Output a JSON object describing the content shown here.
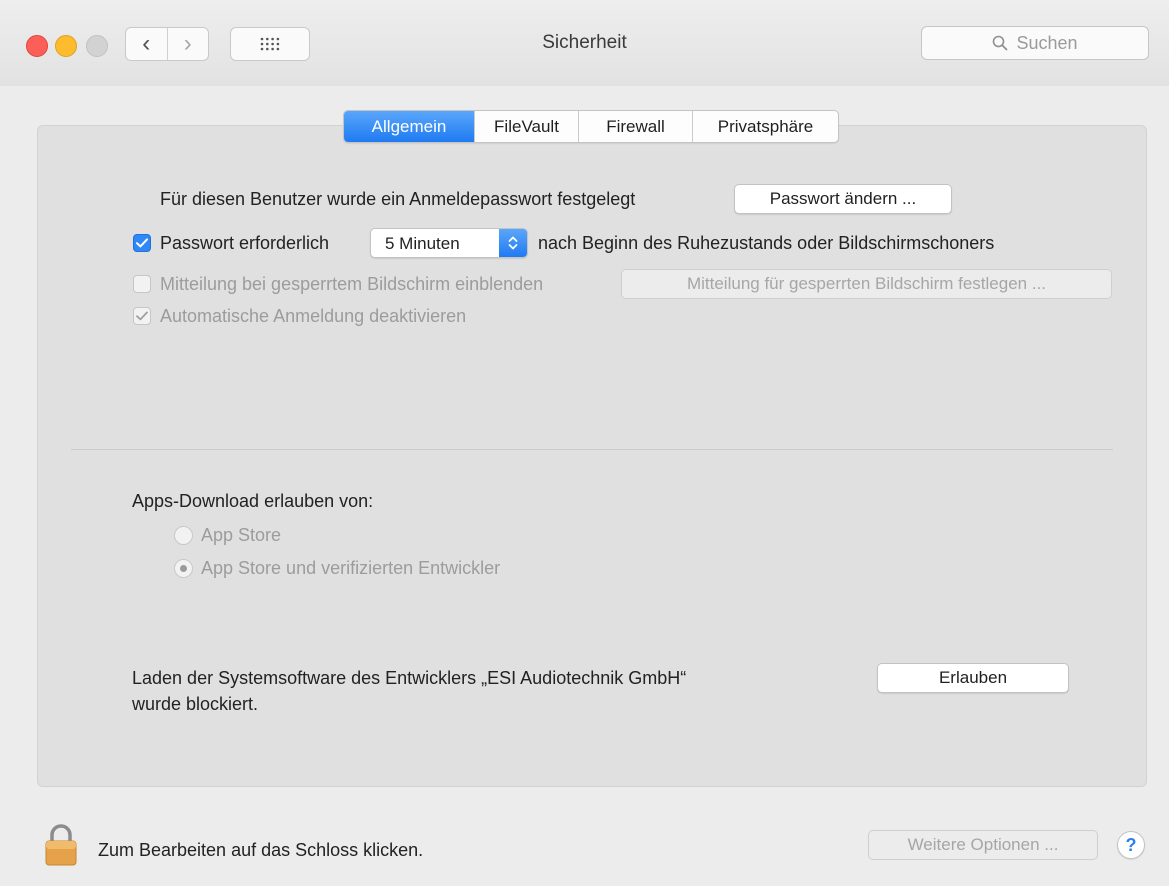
{
  "window": {
    "title": "Sicherheit",
    "search_placeholder": "Suchen"
  },
  "tabs": [
    {
      "label": "Allgemein",
      "selected": true
    },
    {
      "label": "FileVault",
      "selected": false
    },
    {
      "label": "Firewall",
      "selected": false
    },
    {
      "label": "Privatsphäre",
      "selected": false
    }
  ],
  "general": {
    "password_set_label": "Für diesen Benutzer wurde ein Anmeldepasswort festgelegt",
    "change_password_button": "Passwort ändern ...",
    "require_password": {
      "label": "Passwort erforderlich",
      "checked": true
    },
    "require_password_delay": "5 Minuten",
    "require_password_suffix": "nach Beginn des Ruhezustands oder Bildschirmschoners",
    "lock_message": {
      "label": "Mitteilung bei gesperrtem Bildschirm einblenden",
      "checked": false,
      "enabled": false
    },
    "lock_message_button": "Mitteilung für gesperrten Bildschirm festlegen ...",
    "disable_auto_login": {
      "label": "Automatische Anmeldung deaktivieren",
      "checked": true,
      "enabled": false
    }
  },
  "downloads": {
    "heading": "Apps-Download erlauben von:",
    "options": [
      {
        "label": "App Store",
        "selected": false
      },
      {
        "label": "App Store und verifizierten Entwickler",
        "selected": true
      }
    ]
  },
  "blocked": {
    "line1": "Laden der Systemsoftware des Entwicklers „ESI Audiotechnik GmbH“",
    "line2": "wurde blockiert.",
    "allow_button": "Erlauben"
  },
  "footer": {
    "lock_text": "Zum Bearbeiten auf das Schloss klicken.",
    "more_options_button": "Weitere Optionen ...",
    "help_label": "?"
  },
  "colors": {
    "accent": "#2f88f5",
    "close": "#fc5f57",
    "minimize": "#fdbc2e",
    "lock_body": "#e5a24a"
  },
  "icons": [
    "close-icon",
    "minimize-icon",
    "zoom-icon",
    "back-icon",
    "forward-icon",
    "grid-icon",
    "search-icon",
    "checkmark-icon",
    "popup-arrows-icon",
    "lock-icon",
    "help-icon"
  ]
}
